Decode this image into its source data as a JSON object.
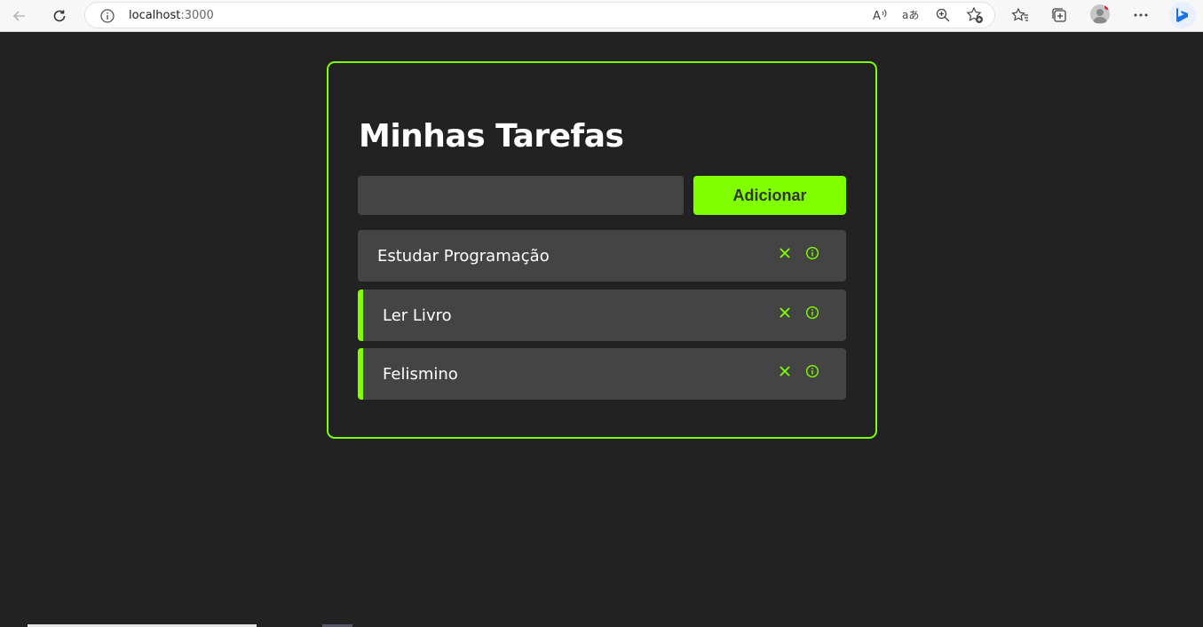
{
  "browser": {
    "url_host": "localhost",
    "url_port": ":3000",
    "icons": [
      "back-icon",
      "refresh-icon",
      "site-info-icon",
      "read-aloud-icon",
      "translate-icon",
      "zoom-icon",
      "add-favorite-icon",
      "favorites-icon",
      "collections-icon",
      "profile-icon",
      "more-icon",
      "bing-icon"
    ]
  },
  "app": {
    "title": "Minhas Tarefas",
    "input_value": "",
    "input_placeholder": "",
    "add_button_label": "Adicionar",
    "accent_color": "#7fff00",
    "tasks": [
      {
        "title": "Estudar Programação",
        "completed": false
      },
      {
        "title": "Ler Livro",
        "completed": true
      },
      {
        "title": "Felismino",
        "completed": true
      }
    ]
  }
}
